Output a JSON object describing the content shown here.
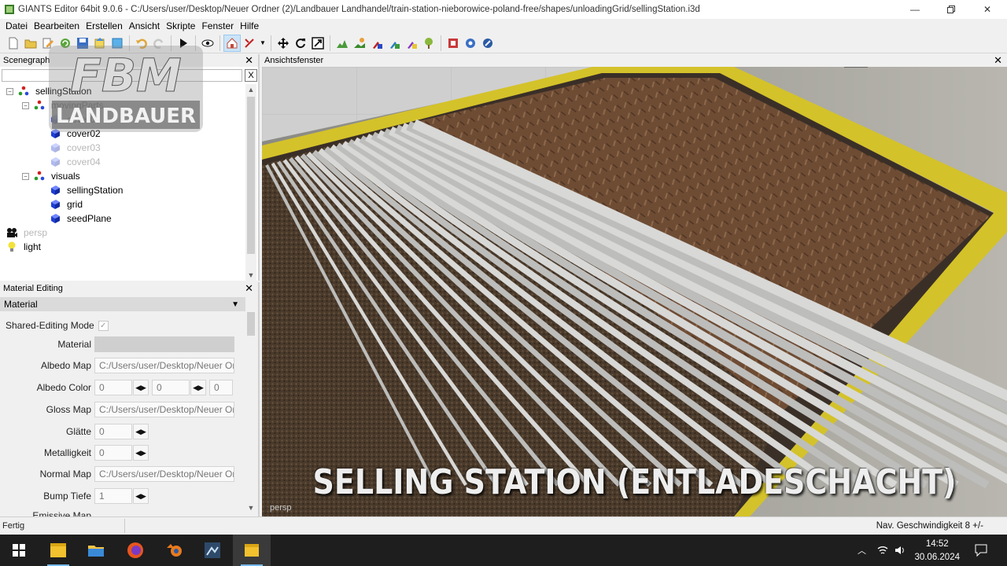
{
  "window": {
    "title": "GIANTS Editor 64bit 9.0.6 - C:/Users/user/Desktop/Neuer Ordner (2)/Landbauer Landhandel/train-station-nieborowice-poland-free/shapes/unloadingGrid/sellingStation.i3d"
  },
  "menu": [
    "Datei",
    "Bearbeiten",
    "Erstellen",
    "Ansicht",
    "Skripte",
    "Fenster",
    "Hilfe"
  ],
  "scenegraph": {
    "title": "Scenegraph",
    "filter_clear": "X",
    "nodes": [
      {
        "label": "sellingStation",
        "icon": "transform-group-icon",
        "dim": false
      },
      {
        "label": "movingParts",
        "icon": "transform-group-icon",
        "dim": false
      },
      {
        "label": "cover01",
        "icon": "shape-cube-icon",
        "dim": false
      },
      {
        "label": "cover02",
        "icon": "shape-cube-icon",
        "dim": false
      },
      {
        "label": "cover03",
        "icon": "shape-cube-icon",
        "dim": true
      },
      {
        "label": "cover04",
        "icon": "shape-cube-icon",
        "dim": true
      },
      {
        "label": "visuals",
        "icon": "transform-group-icon",
        "dim": false
      },
      {
        "label": "sellingStation",
        "icon": "shape-cube-icon",
        "dim": false
      },
      {
        "label": "grid",
        "icon": "shape-cube-icon",
        "dim": false
      },
      {
        "label": "seedPlane",
        "icon": "shape-cube-icon",
        "dim": false
      },
      {
        "label": "persp",
        "icon": "camera-icon",
        "dim": true
      },
      {
        "label": "light",
        "icon": "light-bulb-icon",
        "dim": false
      }
    ]
  },
  "material_panel": {
    "title": "Material Editing",
    "section": "Material",
    "shared_editing_label": "Shared-Editing Mode",
    "shared_editing_checked": true,
    "material_label": "Material",
    "material_value": "",
    "albedo_map_label": "Albedo Map",
    "albedo_map_value": "C:/Users/user/Desktop/Neuer Or",
    "albedo_color_label": "Albedo Color",
    "albedo_color_r": "0",
    "albedo_color_g": "0",
    "albedo_color_b": "0",
    "gloss_map_label": "Gloss Map",
    "gloss_map_value": "C:/Users/user/Desktop/Neuer Or",
    "glaette_label": "Glätte",
    "glaette_value": "0",
    "metalligkeit_label": "Metalligkeit",
    "metalligkeit_value": "0",
    "normal_map_label": "Normal Map",
    "normal_map_value": "C:/Users/user/Desktop/Neuer Or",
    "bump_tiefe_label": "Bump Tiefe",
    "bump_tiefe_value": "1",
    "partial_label": "Emissive Map"
  },
  "viewport": {
    "title": "Ansichtsfenster",
    "camera_label": "persp",
    "caption": "SELLING STATION (ENTLADESCHACHT)"
  },
  "logo": {
    "line1": "FBM",
    "line2": "LANDBAUER"
  },
  "status": {
    "left": "Fertig",
    "right": "Nav. Geschwindigkeit 8 +/-"
  },
  "taskbar": {
    "time": "14:52",
    "date": "30.06.2024"
  },
  "colors": {
    "accent_blue": "#1f3fd8",
    "selection": "#cce4f7",
    "hazard_yellow": "#d4c22a",
    "plate_brown": "#6b4a33"
  }
}
